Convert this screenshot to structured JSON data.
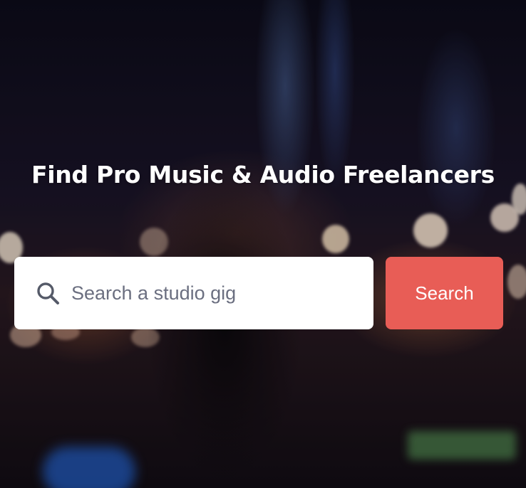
{
  "hero": {
    "headline": "Find Pro Music & Audio Freelancers"
  },
  "search": {
    "placeholder": "Search a studio gig",
    "value": "",
    "icon": "search-icon",
    "button_label": "Search"
  },
  "colors": {
    "button_bg": "#e85d56",
    "button_text": "#ffffff",
    "input_bg": "#ffffff",
    "placeholder": "#6b6f80",
    "headline": "#ffffff"
  }
}
